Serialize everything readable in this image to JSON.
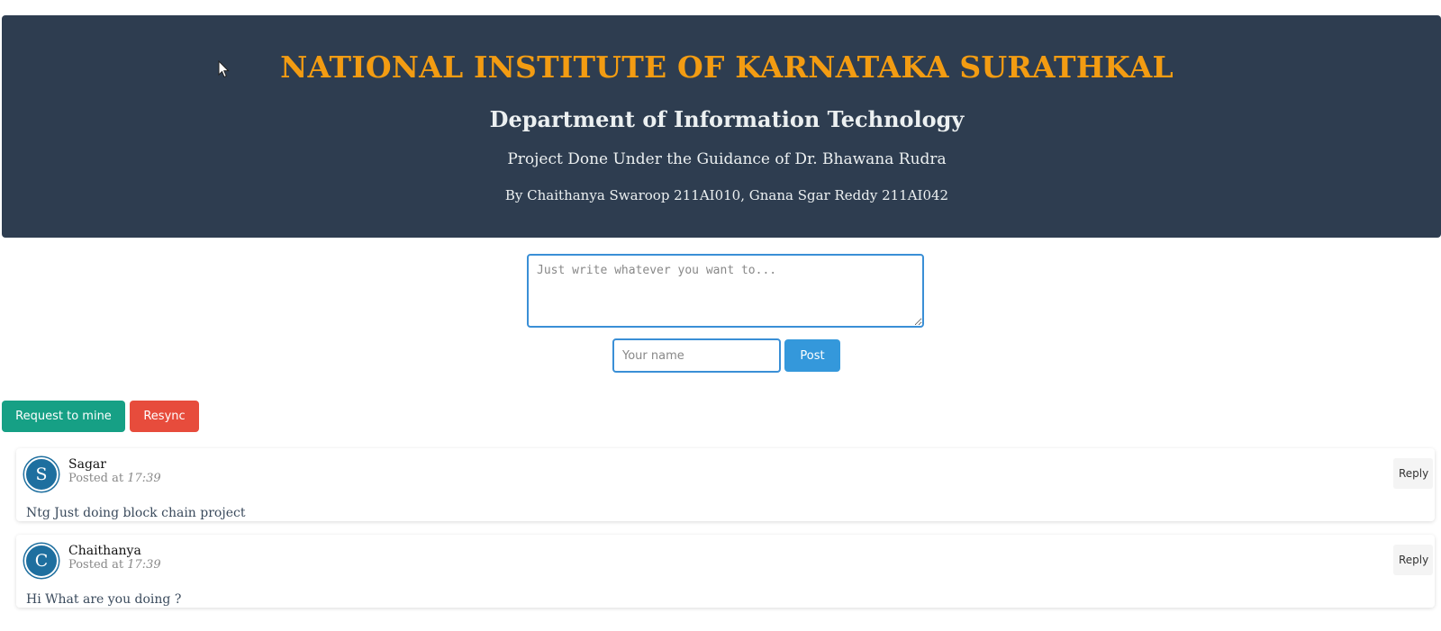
{
  "header": {
    "title": "NATIONAL INSTITUTE OF KARNATAKA SURATHKAL",
    "department": "Department of Information Technology",
    "guidance": "Project Done Under the Guidance of Dr. Bhawana Rudra",
    "authors": "By Chaithanya Swaroop 211AI010, Gnana Sgar Reddy 211AI042"
  },
  "composer": {
    "message_placeholder": "Just write whatever you want to...",
    "message_value": "",
    "name_placeholder": "Your name",
    "name_value": "",
    "post_label": "Post"
  },
  "actions": {
    "mine_label": "Request to mine",
    "resync_label": "Resync"
  },
  "posts": [
    {
      "initial": "S",
      "author": "Sagar",
      "posted_prefix": "Posted at",
      "time": "17:39",
      "text": "Ntg Just doing block chain project",
      "reply_label": "Reply"
    },
    {
      "initial": "C",
      "author": "Chaithanya",
      "posted_prefix": "Posted at",
      "time": "17:39",
      "text": "Hi What are you doing ?",
      "reply_label": "Reply"
    }
  ],
  "colors": {
    "header_bg": "#2e3d50",
    "title": "#f39c12",
    "post_button": "#3498db",
    "mine_button": "#16a085",
    "resync_button": "#e74c3c",
    "avatar": "#1e6f9f"
  },
  "icons": {
    "cursor": "mouse-pointer-icon"
  }
}
